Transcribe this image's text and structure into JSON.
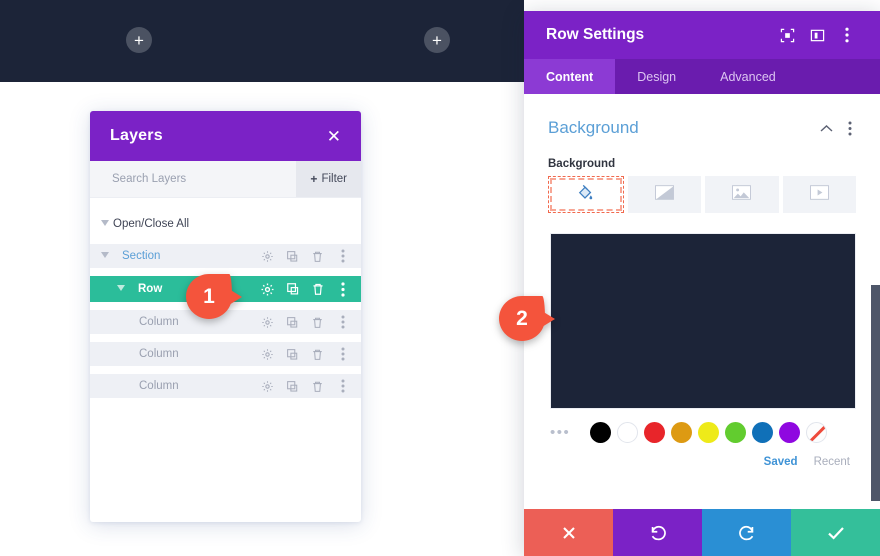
{
  "canvas": {
    "background_color": "#1c2438",
    "add_buttons": [
      {
        "name": "add-section-left",
        "label": "+"
      },
      {
        "name": "add-section-right",
        "label": "+"
      }
    ]
  },
  "layers_panel": {
    "title": "Layers",
    "close_icon": "close-icon",
    "close_label": "✕",
    "header_color": "#7b22c6",
    "search": {
      "value": "",
      "placeholder": "Search Layers"
    },
    "filter_button": {
      "label": "Filter",
      "plus": "+"
    },
    "tree": [
      {
        "label": "Open/Close All",
        "type": "toggle-all",
        "caret": "▾",
        "icons": []
      },
      {
        "label": "Section",
        "type": "section",
        "caret": "▾",
        "icons": [
          "gear-icon",
          "duplicate-icon",
          "trash-icon",
          "more-options-icon"
        ]
      },
      {
        "label": "Row",
        "type": "row",
        "active": true,
        "caret": "▾",
        "icons": [
          "gear-icon",
          "duplicate-icon",
          "trash-icon",
          "more-options-icon"
        ]
      },
      {
        "label": "Column",
        "type": "column",
        "icons": [
          "gear-icon",
          "duplicate-icon",
          "trash-icon",
          "more-options-icon"
        ]
      },
      {
        "label": "Column",
        "type": "column",
        "icons": [
          "gear-icon",
          "duplicate-icon",
          "trash-icon",
          "more-options-icon"
        ]
      },
      {
        "label": "Column",
        "type": "column",
        "icons": [
          "gear-icon",
          "duplicate-icon",
          "trash-icon",
          "more-options-icon"
        ]
      }
    ]
  },
  "settings_panel": {
    "title": "Row Settings",
    "header_color": "#7b22c6",
    "header_icons": [
      "focus-target-icon",
      "panel-layout-icon",
      "more-options-icon"
    ],
    "tabs": [
      {
        "label": "Content",
        "active": true
      },
      {
        "label": "Design",
        "active": false
      },
      {
        "label": "Advanced",
        "active": false
      }
    ],
    "section": {
      "title": "Background",
      "collapse_icon": "chevron-up-icon",
      "options_icon": "more-options-icon"
    },
    "field": {
      "label": "Background",
      "tabs": [
        {
          "name": "background-color-tab",
          "icon": "paint-bucket-icon",
          "active": true
        },
        {
          "name": "background-gradient-tab",
          "icon": "gradient-icon",
          "active": false
        },
        {
          "name": "background-image-tab",
          "icon": "image-icon",
          "active": false
        },
        {
          "name": "background-video-tab",
          "icon": "video-icon",
          "active": false
        }
      ],
      "preview_color": "#1c2438",
      "swatch_dots": "•••",
      "swatches": [
        {
          "name": "swatch-black",
          "color": "#000000"
        },
        {
          "name": "swatch-white",
          "color": "#ffffff"
        },
        {
          "name": "swatch-red",
          "color": "#e8252a"
        },
        {
          "name": "swatch-orange",
          "color": "#dd9a13"
        },
        {
          "name": "swatch-yellow",
          "color": "#eeea19"
        },
        {
          "name": "swatch-green",
          "color": "#62cc2f"
        },
        {
          "name": "swatch-blue",
          "color": "#1070b8"
        },
        {
          "name": "swatch-purple",
          "color": "#8f08e0"
        }
      ],
      "no_color_swatch": "swatch-transparent",
      "saved_label": "Saved",
      "recent_label": "Recent"
    },
    "footer": [
      {
        "name": "discard-button",
        "icon": "close-icon",
        "glyph": "✕",
        "color": "#ec5f56"
      },
      {
        "name": "undo-button",
        "icon": "undo-icon",
        "glyph": "↺",
        "color": "#7b22c6"
      },
      {
        "name": "redo-button",
        "icon": "redo-icon",
        "glyph": "↻",
        "color": "#2a8fd4"
      },
      {
        "name": "save-button",
        "icon": "check-icon",
        "glyph": "✓",
        "color": "#34bf9a"
      }
    ]
  },
  "callouts": [
    {
      "number": "1",
      "color": "#f4543c"
    },
    {
      "number": "2",
      "color": "#f4543c"
    }
  ]
}
